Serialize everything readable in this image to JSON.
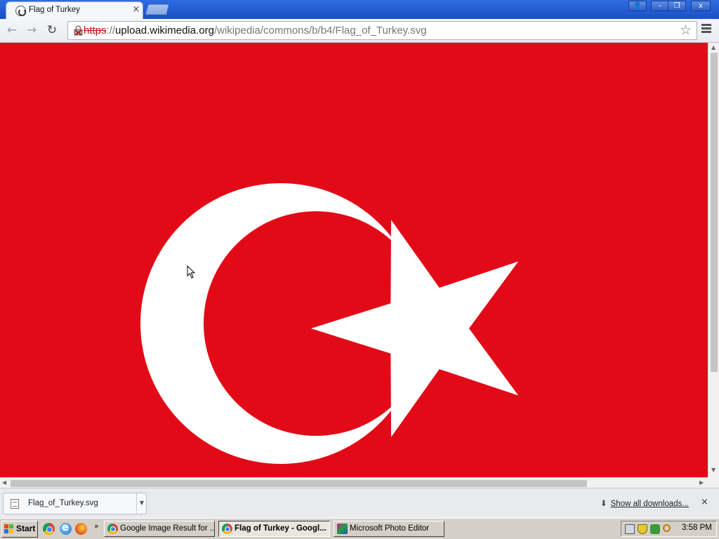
{
  "browser": {
    "tab": {
      "title": "Flag of Turkey",
      "close_label": "×"
    },
    "window_controls": {
      "profile": "👤",
      "minimize": "–",
      "restore": "❐",
      "close": "x"
    },
    "toolbar": {
      "back_label": "←",
      "forward_label": "→",
      "reload_label": "↻",
      "star_label": "☆"
    },
    "address_bar": {
      "scheme": "https",
      "separator": "://",
      "host": "upload.wikimedia.org",
      "path": "/wikipedia/commons/b/b4/Flag_of_Turkey.svg"
    }
  },
  "content": {
    "flag_colors": {
      "background": "#e30a17",
      "emblem": "#ffffff"
    }
  },
  "download_shelf": {
    "item": {
      "filename": "Flag_of_Turkey.svg",
      "dropdown_label": "▼"
    },
    "show_all_label": "Show all downloads...",
    "show_all_icon": "⬇",
    "close_label": "×"
  },
  "taskbar": {
    "start_label": "Start",
    "quicklaunch_more": "»",
    "tasks": [
      {
        "label": "Google Image Result for ...",
        "icon": "chrome-icon",
        "active": false
      },
      {
        "label": "Flag of Turkey - Googl...",
        "icon": "chrome-icon",
        "active": true
      },
      {
        "label": "Microsoft Photo Editor",
        "icon": "photo-editor-icon",
        "active": false
      }
    ],
    "clock": "3:58 PM"
  }
}
